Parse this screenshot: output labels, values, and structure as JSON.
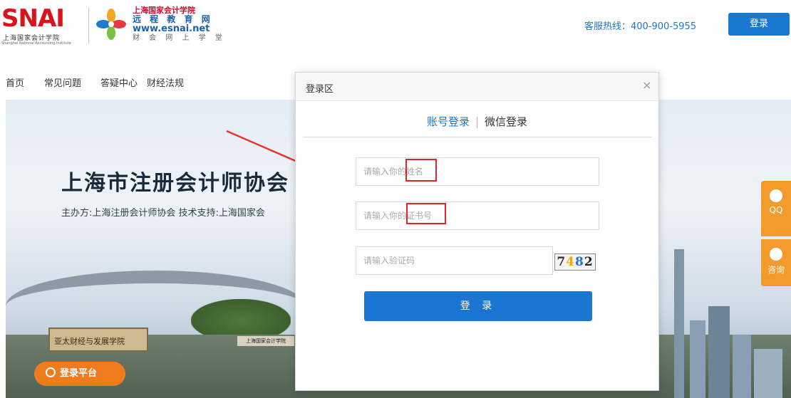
{
  "header": {
    "snai_logo_text": "SNAI",
    "snai_chinese": "上海国家会计学院",
    "snai_english": "Shanghai National Accounting Institute",
    "logo_line1": "上海国家会计学院",
    "logo_line2": "远 程 教 育 网",
    "logo_line3": "www.esnai.net",
    "logo_line4": "财 会 网 上 学 堂",
    "hotline": "客服热线：400-900-5955",
    "login_button": "登录"
  },
  "nav": {
    "items": [
      "首页",
      "常见问题",
      "答疑中心",
      "财经法规"
    ]
  },
  "banner": {
    "title": "上海市注册会计师协会",
    "subtitle": "主办方:上海注册会计师协会 技术支持:上海国家会",
    "gate_sign": "亚太财经与发展学院",
    "gate_sign2": "上海国家会计学院",
    "platform_button": "登录平台",
    "side_qq": "QQ",
    "side_chat": "咨询"
  },
  "modal": {
    "title": "登录区",
    "close": "×",
    "tab_account": "账号登录",
    "tab_separator": "|",
    "tab_wechat": "微信登录",
    "name_placeholder": "请输入你的姓名",
    "cert_placeholder": "请输入你的证书号",
    "code_placeholder": "请输入验证码",
    "captcha": [
      "7",
      "4",
      "8",
      "2"
    ],
    "submit": "登 录"
  },
  "colors": {
    "brand_blue": "#1b76d1",
    "snai_red": "#d7141a",
    "accent_orange": "#f39a2c",
    "highlight_red": "#e32526"
  }
}
